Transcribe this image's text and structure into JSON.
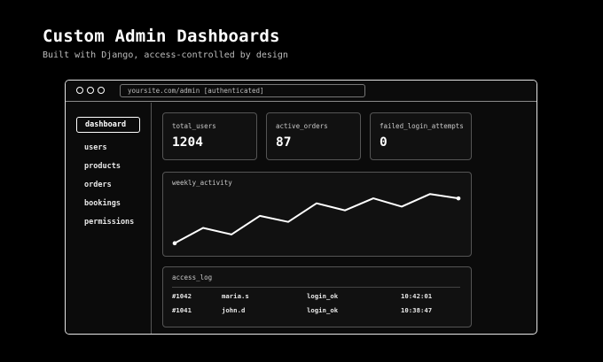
{
  "header": {
    "title": "Custom Admin Dashboards",
    "subtitle": "Built with Django, access-controlled by design"
  },
  "browser": {
    "url": "yoursite.com/admin [authenticated]"
  },
  "sidebar": {
    "items": [
      {
        "label": "dashboard",
        "active": true
      },
      {
        "label": "users"
      },
      {
        "label": "products"
      },
      {
        "label": "orders"
      },
      {
        "label": "bookings"
      },
      {
        "label": "permissions"
      }
    ]
  },
  "stats": [
    {
      "label": "total_users",
      "value": "1204"
    },
    {
      "label": "active_orders",
      "value": "87"
    },
    {
      "label": "failed_login_attempts",
      "value": "0"
    }
  ],
  "chart_data": {
    "type": "line",
    "title": "weekly_activity",
    "x": [
      1,
      2,
      3,
      4,
      5,
      6,
      7,
      8,
      9,
      10,
      11
    ],
    "series": [
      {
        "values": [
          10,
          38,
          26,
          60,
          49,
          83,
          70,
          92,
          77,
          100,
          92
        ]
      }
    ],
    "ylim": [
      0,
      110
    ],
    "grid": false
  },
  "access_log": {
    "title": "access_log",
    "rows": [
      {
        "id": "#1042",
        "user": "maria.s",
        "event": "login_ok",
        "time": "10:42:01"
      },
      {
        "id": "#1041",
        "user": "john.d",
        "event": "login_ok",
        "time": "10:38:47"
      }
    ]
  },
  "colors": {
    "background": "#000000",
    "panel": "#111111",
    "border": "#555555",
    "accent": "#ffffff"
  }
}
